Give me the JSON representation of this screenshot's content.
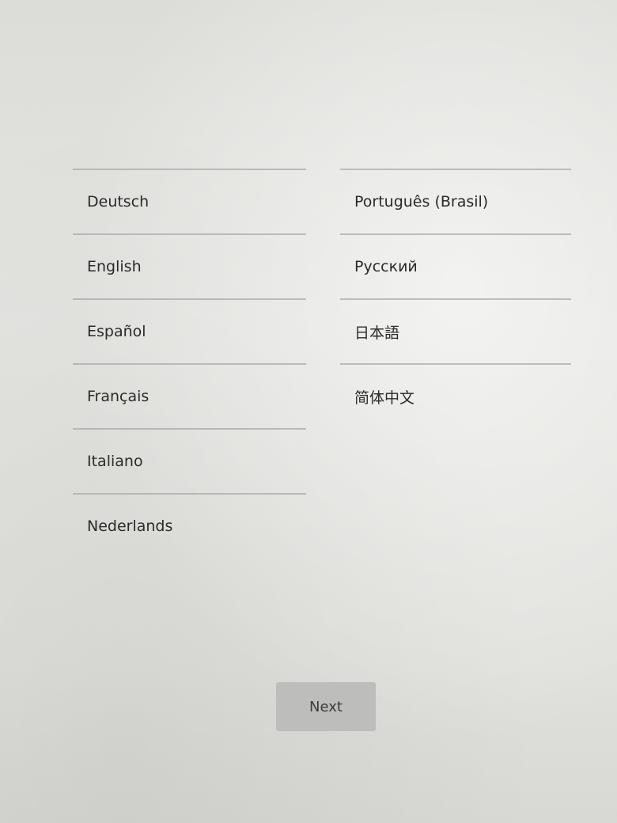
{
  "languages": {
    "left": [
      {
        "label": "Deutsch"
      },
      {
        "label": "English"
      },
      {
        "label": "Español"
      },
      {
        "label": "Français"
      },
      {
        "label": "Italiano"
      },
      {
        "label": "Nederlands"
      }
    ],
    "right": [
      {
        "label": "Português (Brasil)"
      },
      {
        "label": "Русский"
      },
      {
        "label": "日本語"
      },
      {
        "label": "简体中文"
      }
    ]
  },
  "next_button": {
    "label": "Next"
  }
}
